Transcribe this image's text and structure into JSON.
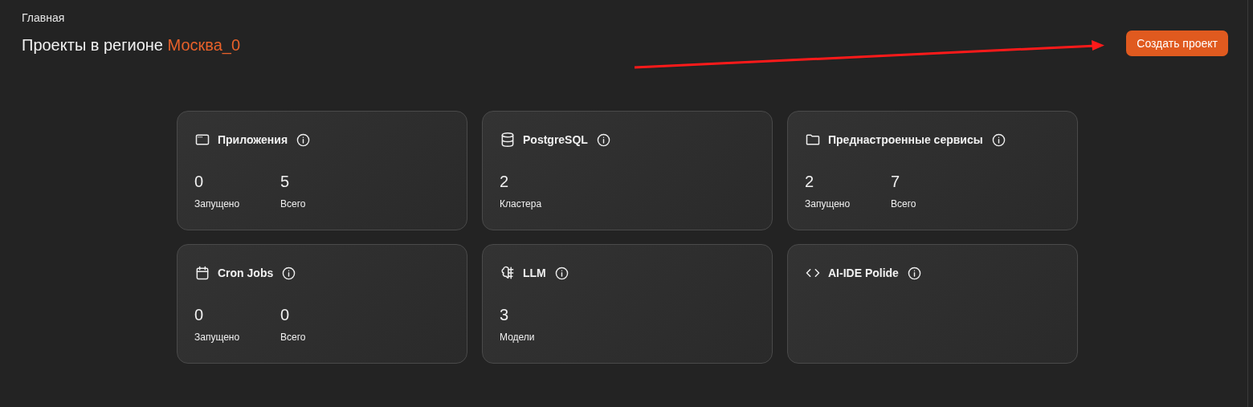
{
  "breadcrumb": "Главная",
  "title": {
    "text": "Проекты в регионе ",
    "region": "Москва_0"
  },
  "create_button": "Создать проект",
  "annotation": {
    "kind": "arrow"
  },
  "cards": [
    {
      "title": "Приложения",
      "stats": [
        {
          "value": "0",
          "label": "Запущено"
        },
        {
          "value": "5",
          "label": "Всего"
        }
      ]
    },
    {
      "title": "PostgreSQL",
      "stats": [
        {
          "value": "2",
          "label": "Кластера"
        }
      ]
    },
    {
      "title": "Преднастроенные сервисы",
      "stats": [
        {
          "value": "2",
          "label": "Запущено"
        },
        {
          "value": "7",
          "label": "Всего"
        }
      ]
    },
    {
      "title": "Cron Jobs",
      "stats": [
        {
          "value": "0",
          "label": "Запущено"
        },
        {
          "value": "0",
          "label": "Всего"
        }
      ]
    },
    {
      "title": "LLM",
      "stats": [
        {
          "value": "3",
          "label": "Модели"
        }
      ]
    },
    {
      "title": "AI-IDE Polide"
    }
  ]
}
